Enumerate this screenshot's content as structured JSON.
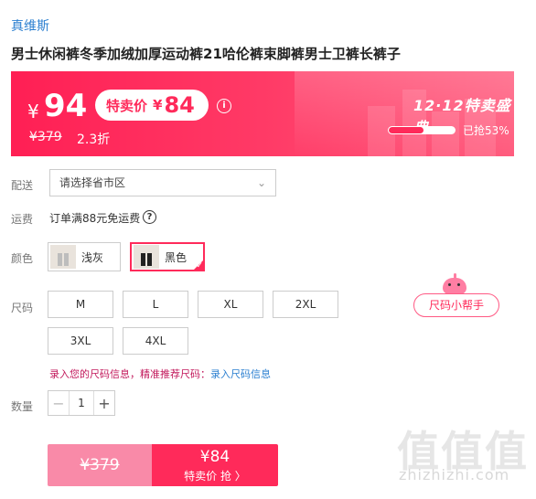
{
  "brand": "真维斯",
  "title": "男士休闲裤冬季加绒加厚运动裤21哈伦裤束脚裤男士卫裤长裤子",
  "banner": {
    "currency": "¥",
    "price": "94",
    "promo_label": "特卖价",
    "promo_currency": "¥",
    "promo_price": "84",
    "info_icon": "i",
    "original_price": "¥379",
    "discount": "2.3折",
    "event_name": "12·12特卖盛典",
    "sold_text": "已抢53%",
    "sold_fraction": 0.53,
    "accent_color": "#ff2a5a"
  },
  "delivery": {
    "label": "配送",
    "placeholder": "请选择省市区",
    "chevron": "⌄"
  },
  "shipping": {
    "label": "运费",
    "text": "订单满88元免运费",
    "help": "?"
  },
  "color": {
    "label": "颜色",
    "options": [
      {
        "name": "浅灰",
        "selected": false
      },
      {
        "name": "黑色",
        "selected": true
      }
    ],
    "check": "✓"
  },
  "size": {
    "label": "尺码",
    "options": [
      "M",
      "L",
      "XL",
      "2XL",
      "3XL",
      "4XL"
    ],
    "helper": "尺码小帮手",
    "hint_prefix": "录入您的尺码信息，精准推荐尺码：",
    "hint_link": "录入尺码信息"
  },
  "quantity": {
    "label": "数量",
    "value": "1",
    "minus": "−",
    "plus": "+"
  },
  "buy": {
    "original": "¥379",
    "price": "¥84",
    "action": "特卖价 抢 〉"
  },
  "watermark": {
    "glyphs": "值值值",
    "site": "zhizhizhi.com"
  }
}
